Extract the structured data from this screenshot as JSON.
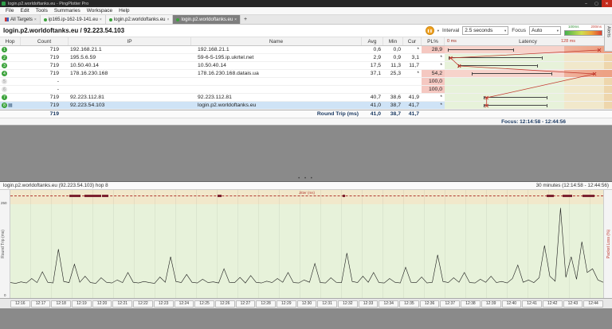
{
  "colors": {
    "titlebar": "#262626",
    "accent_orange": "#f0a01e",
    "selection": "#cfe3f6",
    "loss_pink": "#f5c8c1",
    "green": "#e7f2da",
    "tan": "#f1e8cb",
    "band_orange": "#eed6ac",
    "red": "#c23a2e",
    "navy": "#17365f",
    "hop_green": "#3aa23a"
  },
  "window": {
    "title": "login.p2.worldoftanks.eu - PingPlotter Pro",
    "controls": {
      "minimize": "–",
      "maximize": "▢",
      "close": "✕"
    }
  },
  "menu": [
    "File",
    "Edit",
    "Tools",
    "Summaries",
    "Workspace",
    "Help"
  ],
  "tabbar": {
    "all_targets": "All Targets",
    "tabs": [
      {
        "label": "ip165.ip-162-19-141.eu",
        "active": false
      },
      {
        "label": "login.p2.worldoftanks.eu",
        "active": false
      },
      {
        "label": "login.p2.worldoftanks.eu",
        "active": true
      }
    ],
    "new_tab": "+",
    "close_glyph": "×",
    "alerts": "Alerts"
  },
  "target": {
    "title": "login.p2.worldoftanks.eu / 92.223.54.103"
  },
  "toolbar": {
    "pause_glyph": "❚❚",
    "caret": "▾",
    "interval_label": "Interval",
    "interval_value": "2.5 seconds",
    "focus_label": "Focus",
    "focus_value": "Auto",
    "legend_low": "100ms",
    "legend_high": "200ms"
  },
  "trace": {
    "headers": {
      "hop": "Hop",
      "count": "Count",
      "ip": "IP",
      "name": "Name",
      "avg": "Avg",
      "min": "Min",
      "cur": "Cur",
      "pl": "PL%",
      "latency": "Latency"
    },
    "scale": {
      "min": "0 ms",
      "max": "128 ms"
    },
    "rows": [
      {
        "hop": "1",
        "count": "719",
        "ip": "192.168.21.1",
        "name": "192.168.21.1",
        "avg": "0,6",
        "min": "0,0",
        "cur": "*",
        "pl": "28,9",
        "loss": true,
        "marker_ms": 160,
        "range_ms": [
          0,
          70
        ]
      },
      {
        "hop": "2",
        "count": "719",
        "ip": "195.5.6.59",
        "name": "59-6-5-195.ip.ukrtel.net",
        "avg": "2,9",
        "min": "0,9",
        "cur": "3,1",
        "pl": "*",
        "loss": false,
        "marker_ms": 3,
        "range_ms": [
          1,
          100
        ]
      },
      {
        "hop": "3",
        "count": "719",
        "ip": "10.50.40.14",
        "name": "10.50.40.14",
        "avg": "17,5",
        "min": "11,3",
        "cur": "11,7",
        "pl": "*",
        "loss": false,
        "marker_ms": 12,
        "range_ms": [
          11,
          95
        ]
      },
      {
        "hop": "4",
        "count": "719",
        "ip": "178.16.230.168",
        "name": "178.16.230.168.datais.ua",
        "avg": "37,1",
        "min": "25,3",
        "cur": "*",
        "pl": "54,2",
        "loss": true,
        "marker_ms": 155,
        "range_ms": [
          25,
          110
        ]
      },
      {
        "hop": "5",
        "count": "-",
        "ip": "",
        "name": "",
        "avg": "",
        "min": "",
        "cur": "",
        "pl": "100,0",
        "loss": true,
        "ghost": true
      },
      {
        "hop": "6",
        "count": "-",
        "ip": "",
        "name": "",
        "avg": "",
        "min": "",
        "cur": "",
        "pl": "100,0",
        "loss": true,
        "ghost": true
      },
      {
        "hop": "7",
        "count": "719",
        "ip": "92.223.112.81",
        "name": "92.223.112.81",
        "avg": "40,7",
        "min": "38,6",
        "cur": "41,9",
        "pl": "*",
        "loss": false,
        "marker_ms": 41,
        "range_ms": [
          38,
          105
        ]
      },
      {
        "hop": "8",
        "count": "719",
        "ip": "92.223.54.103",
        "name": "login.p2.worldoftanks.eu",
        "avg": "41,0",
        "min": "38,7",
        "cur": "41,7",
        "pl": "*",
        "loss": false,
        "selected": true,
        "marker_ms": 41,
        "range_ms": [
          38,
          105
        ]
      }
    ],
    "summary": {
      "count": "719",
      "label": "Round Trip (ms)",
      "avg": "41,0",
      "min": "38,7",
      "cur": "41,7"
    },
    "focus_label": "Focus: 12:14:58 - 12:44:56"
  },
  "timeline": {
    "title": "login.p2.worldoftanks.eu (92.223.54.103) hop 8",
    "range_label": "30 minutes (12:14:58 - 12:44:56)",
    "axis_left_label": "Round Trip (ms)",
    "axis_right_label": "Packet Loss (%)",
    "overlay_label": "Jitter (ms)",
    "y_max_label": "250",
    "y_min_label": "0",
    "y_scale_max": 250,
    "x_labels": [
      "12:16",
      "12:17",
      "12:18",
      "12:19",
      "12:20",
      "12:21",
      "12:22",
      "12:23",
      "12:24",
      "12:25",
      "12:26",
      "12:27",
      "12:28",
      "12:29",
      "12:30",
      "12:31",
      "12:32",
      "12:33",
      "12:34",
      "12:35",
      "12:36",
      "12:37",
      "12:38",
      "12:39",
      "12:40",
      "12:41",
      "12:42",
      "12:43",
      "12:44"
    ],
    "latency_ms": [
      41,
      39,
      43,
      40,
      52,
      41,
      70,
      42,
      40,
      130,
      44,
      41,
      90,
      42,
      58,
      41,
      39,
      54,
      42,
      40,
      48,
      41,
      68,
      42,
      40,
      44,
      41,
      39,
      56,
      42,
      110,
      44,
      41,
      63,
      42,
      40,
      50,
      41,
      43,
      40,
      78,
      42,
      41,
      55,
      40,
      60,
      42,
      40,
      45,
      41,
      52,
      42,
      68,
      41,
      40,
      48,
      42,
      92,
      41,
      40,
      54,
      42,
      41,
      120,
      44,
      41,
      58,
      42,
      68,
      41,
      40,
      52,
      42,
      40,
      82,
      42,
      41,
      56,
      40,
      42,
      115,
      44,
      41,
      54,
      42,
      68,
      41,
      40,
      50,
      42,
      58,
      41,
      44,
      40,
      52,
      88,
      42,
      48,
      41,
      54,
      140,
      58,
      45,
      240,
      55,
      110,
      50,
      150,
      68,
      78,
      48,
      42
    ],
    "loss_marks": [
      {
        "x": 0.1,
        "w": 0.018
      },
      {
        "x": 0.125,
        "w": 0.028
      },
      {
        "x": 0.155,
        "w": 0.01
      },
      {
        "x": 0.35,
        "w": 0.006
      },
      {
        "x": 0.56,
        "w": 0.005
      },
      {
        "x": 0.905,
        "w": 0.012
      },
      {
        "x": 0.932,
        "w": 0.015
      },
      {
        "x": 0.965,
        "w": 0.02
      }
    ]
  }
}
